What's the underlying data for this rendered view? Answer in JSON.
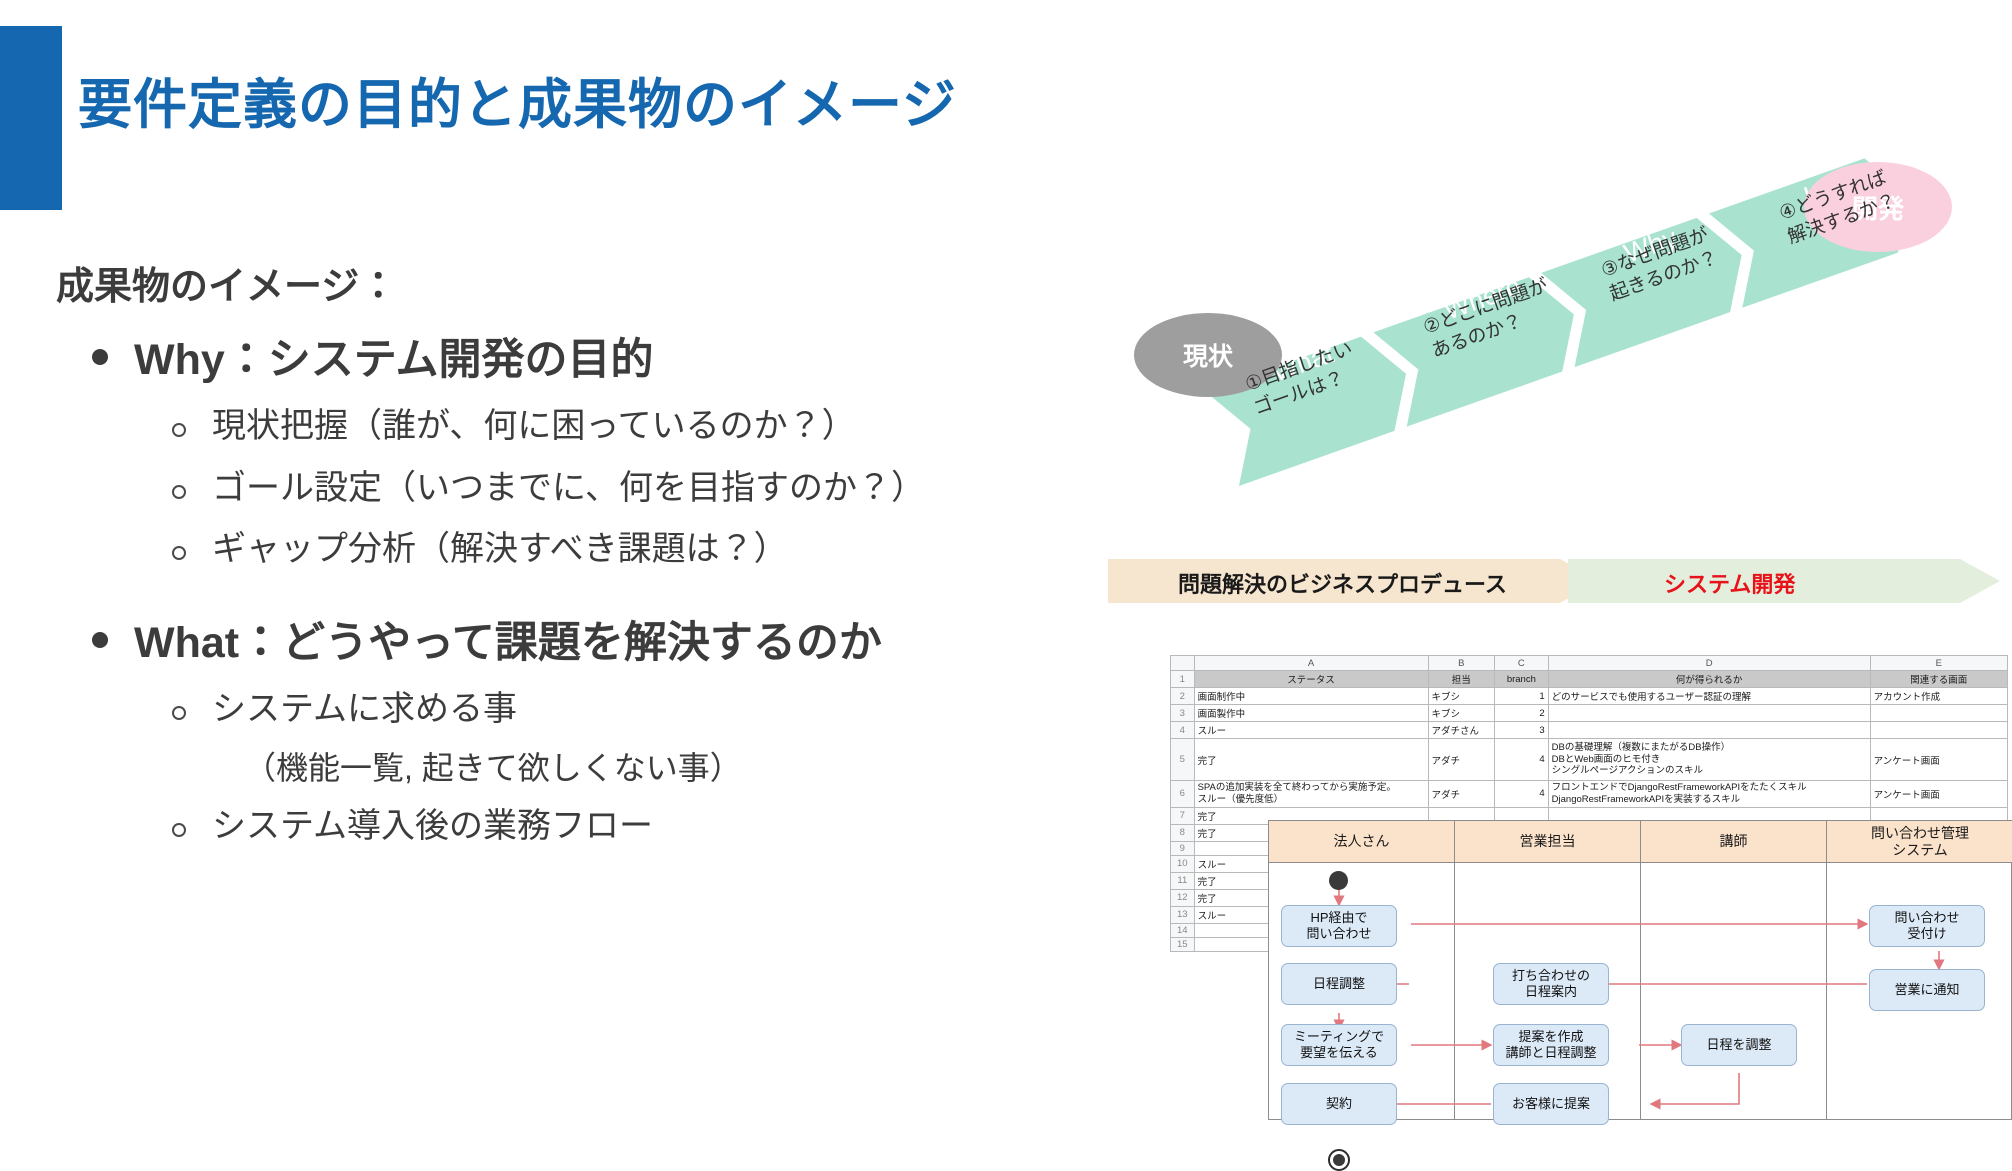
{
  "slide": {
    "title": "要件定義の目的と成果物のイメージ",
    "accent_color": "#1568af",
    "lead": "成果物のイメージ：",
    "bullets": [
      {
        "label": "Why：システム開発の目的",
        "subs": [
          "現状把握（誰が、何に困っているのか？）",
          "ゴール設定（いつまでに、何を目指すのか？）",
          "ギャップ分析（解決すべき課題は？）"
        ]
      },
      {
        "label": "What：どうやって課題を解決するのか",
        "subs": [
          "システムに求める事",
          "システム導入後の業務フロー"
        ],
        "note": "（機能一覧, 起きて欲しくない事）"
      }
    ]
  },
  "diagram": {
    "start_label": "現状",
    "end_label": "開発",
    "start_color": "#9e9e9e",
    "end_color": "#fbd0de",
    "chevron_color": "#a9e3cf",
    "steps": [
      {
        "en": "What",
        "jp": "①目指したい\nゴールは？"
      },
      {
        "en": "Where",
        "jp": "②どこに問題が\nあるのか？"
      },
      {
        "en": "Why",
        "jp": "③なぜ問題が\n起きるのか？"
      },
      {
        "en": "How",
        "jp": "④どうすれば\n解決するか？"
      }
    ]
  },
  "banner": {
    "left_label": "問題解決のビジネスプロデュース",
    "right_label": "システム開発",
    "left_bg": "#f7e6cf",
    "right_bg": "#e3eedc",
    "left_color": "#1a1a1a",
    "right_color": "#e8131a"
  },
  "spreadsheet": {
    "column_letters": [
      "A",
      "B",
      "C",
      "D",
      "E"
    ],
    "headers": [
      "ステータス",
      "担当",
      "branch",
      "何が得られるか",
      "関連する画面"
    ],
    "rows": [
      {
        "n": "2",
        "a": "画面制作中",
        "b": "キブシ",
        "c": "1",
        "d": "どのサービスでも使用するユーザー認証の理解",
        "e": "アカウント作成"
      },
      {
        "n": "3",
        "a": "画面製作中",
        "b": "キブシ",
        "c": "2",
        "d": "",
        "e": ""
      },
      {
        "n": "4",
        "a": "スルー",
        "b": "アダチさん",
        "c": "3",
        "d": "",
        "e": ""
      },
      {
        "n": "5",
        "a": "完了",
        "b": "アダチ",
        "c": "4",
        "d": "DBの基礎理解（複数にまたがるDB操作）\nDBとWeb画面のヒモ付き\nシングルページアクションのスキル",
        "e": "アンケート画面"
      },
      {
        "n": "6",
        "a": "SPAの追加実装を全て終わってから実施予定。\nスルー（優先度低）",
        "b": "アダチ",
        "c": "4",
        "d": "フロントエンドでDjangoRestFrameworkAPIをたたくスキル\nDjangoRestFrameworkAPIを実装するスキル",
        "e": "アンケート画面"
      },
      {
        "n": "7",
        "a": "完了",
        "b": "",
        "c": "",
        "d": "",
        "e": ""
      },
      {
        "n": "8",
        "a": "完了",
        "b": "",
        "c": "",
        "d": "",
        "e": ""
      },
      {
        "n": "9",
        "a": "",
        "b": "",
        "c": "",
        "d": "",
        "e": ""
      },
      {
        "n": "10",
        "a": "スルー",
        "b": "",
        "c": "",
        "d": "",
        "e": ""
      },
      {
        "n": "11",
        "a": "完了",
        "b": "",
        "c": "",
        "d": "",
        "e": ""
      },
      {
        "n": "12",
        "a": "完了",
        "b": "",
        "c": "",
        "d": "",
        "e": ""
      },
      {
        "n": "13",
        "a": "スルー",
        "b": "",
        "c": "",
        "d": "",
        "e": ""
      },
      {
        "n": "14",
        "a": "",
        "b": "",
        "c": "",
        "d": "",
        "e": ""
      },
      {
        "n": "15",
        "a": "",
        "b": "",
        "c": "",
        "d": "",
        "e": ""
      }
    ]
  },
  "flowchart": {
    "lanes": [
      "法人さん",
      "営業担当",
      "講師",
      "問い合わせ管理\nシステム"
    ],
    "lane_header_bg": "#fbe2cb",
    "node_bg": "#dce9f7",
    "arrow_color": "#e2787f",
    "nodes": [
      {
        "id": "n1",
        "label": "HP経由で\n問い合わせ"
      },
      {
        "id": "n2",
        "label": "日程調整"
      },
      {
        "id": "n3",
        "label": "ミーティングで\n要望を伝える"
      },
      {
        "id": "n4",
        "label": "契約"
      },
      {
        "id": "n5",
        "label": "打ち合わせの\n日程案内"
      },
      {
        "id": "n6",
        "label": "提案を作成\n講師と日程調整"
      },
      {
        "id": "n7",
        "label": "お客様に提案"
      },
      {
        "id": "n8",
        "label": "日程を調整"
      },
      {
        "id": "n9",
        "label": "問い合わせ\n受付け"
      },
      {
        "id": "n10",
        "label": "営業に通知"
      }
    ]
  }
}
